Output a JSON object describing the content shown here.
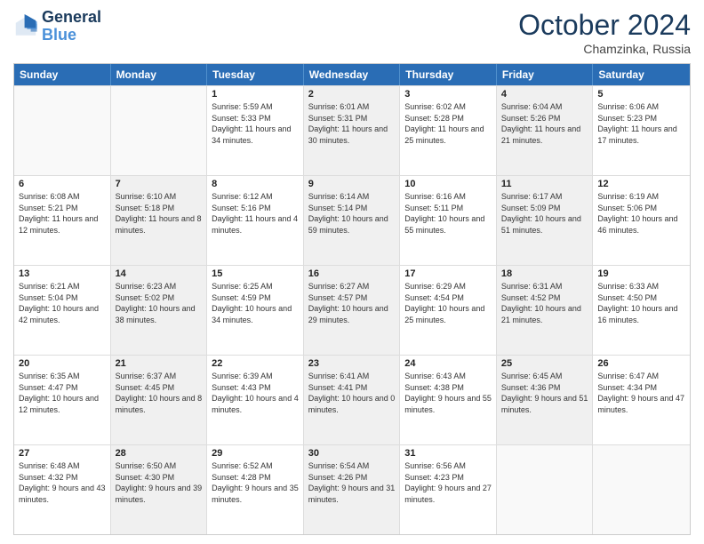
{
  "logo": {
    "line1": "General",
    "line2": "Blue"
  },
  "title": "October 2024",
  "subtitle": "Chamzinka, Russia",
  "days": [
    "Sunday",
    "Monday",
    "Tuesday",
    "Wednesday",
    "Thursday",
    "Friday",
    "Saturday"
  ],
  "weeks": [
    [
      {
        "day": "",
        "sunrise": "",
        "sunset": "",
        "daylight": "",
        "shaded": false,
        "empty": true
      },
      {
        "day": "",
        "sunrise": "",
        "sunset": "",
        "daylight": "",
        "shaded": false,
        "empty": true
      },
      {
        "day": "1",
        "sunrise": "Sunrise: 5:59 AM",
        "sunset": "Sunset: 5:33 PM",
        "daylight": "Daylight: 11 hours and 34 minutes.",
        "shaded": false,
        "empty": false
      },
      {
        "day": "2",
        "sunrise": "Sunrise: 6:01 AM",
        "sunset": "Sunset: 5:31 PM",
        "daylight": "Daylight: 11 hours and 30 minutes.",
        "shaded": true,
        "empty": false
      },
      {
        "day": "3",
        "sunrise": "Sunrise: 6:02 AM",
        "sunset": "Sunset: 5:28 PM",
        "daylight": "Daylight: 11 hours and 25 minutes.",
        "shaded": false,
        "empty": false
      },
      {
        "day": "4",
        "sunrise": "Sunrise: 6:04 AM",
        "sunset": "Sunset: 5:26 PM",
        "daylight": "Daylight: 11 hours and 21 minutes.",
        "shaded": true,
        "empty": false
      },
      {
        "day": "5",
        "sunrise": "Sunrise: 6:06 AM",
        "sunset": "Sunset: 5:23 PM",
        "daylight": "Daylight: 11 hours and 17 minutes.",
        "shaded": false,
        "empty": false
      }
    ],
    [
      {
        "day": "6",
        "sunrise": "Sunrise: 6:08 AM",
        "sunset": "Sunset: 5:21 PM",
        "daylight": "Daylight: 11 hours and 12 minutes.",
        "shaded": false,
        "empty": false
      },
      {
        "day": "7",
        "sunrise": "Sunrise: 6:10 AM",
        "sunset": "Sunset: 5:18 PM",
        "daylight": "Daylight: 11 hours and 8 minutes.",
        "shaded": true,
        "empty": false
      },
      {
        "day": "8",
        "sunrise": "Sunrise: 6:12 AM",
        "sunset": "Sunset: 5:16 PM",
        "daylight": "Daylight: 11 hours and 4 minutes.",
        "shaded": false,
        "empty": false
      },
      {
        "day": "9",
        "sunrise": "Sunrise: 6:14 AM",
        "sunset": "Sunset: 5:14 PM",
        "daylight": "Daylight: 10 hours and 59 minutes.",
        "shaded": true,
        "empty": false
      },
      {
        "day": "10",
        "sunrise": "Sunrise: 6:16 AM",
        "sunset": "Sunset: 5:11 PM",
        "daylight": "Daylight: 10 hours and 55 minutes.",
        "shaded": false,
        "empty": false
      },
      {
        "day": "11",
        "sunrise": "Sunrise: 6:17 AM",
        "sunset": "Sunset: 5:09 PM",
        "daylight": "Daylight: 10 hours and 51 minutes.",
        "shaded": true,
        "empty": false
      },
      {
        "day": "12",
        "sunrise": "Sunrise: 6:19 AM",
        "sunset": "Sunset: 5:06 PM",
        "daylight": "Daylight: 10 hours and 46 minutes.",
        "shaded": false,
        "empty": false
      }
    ],
    [
      {
        "day": "13",
        "sunrise": "Sunrise: 6:21 AM",
        "sunset": "Sunset: 5:04 PM",
        "daylight": "Daylight: 10 hours and 42 minutes.",
        "shaded": false,
        "empty": false
      },
      {
        "day": "14",
        "sunrise": "Sunrise: 6:23 AM",
        "sunset": "Sunset: 5:02 PM",
        "daylight": "Daylight: 10 hours and 38 minutes.",
        "shaded": true,
        "empty": false
      },
      {
        "day": "15",
        "sunrise": "Sunrise: 6:25 AM",
        "sunset": "Sunset: 4:59 PM",
        "daylight": "Daylight: 10 hours and 34 minutes.",
        "shaded": false,
        "empty": false
      },
      {
        "day": "16",
        "sunrise": "Sunrise: 6:27 AM",
        "sunset": "Sunset: 4:57 PM",
        "daylight": "Daylight: 10 hours and 29 minutes.",
        "shaded": true,
        "empty": false
      },
      {
        "day": "17",
        "sunrise": "Sunrise: 6:29 AM",
        "sunset": "Sunset: 4:54 PM",
        "daylight": "Daylight: 10 hours and 25 minutes.",
        "shaded": false,
        "empty": false
      },
      {
        "day": "18",
        "sunrise": "Sunrise: 6:31 AM",
        "sunset": "Sunset: 4:52 PM",
        "daylight": "Daylight: 10 hours and 21 minutes.",
        "shaded": true,
        "empty": false
      },
      {
        "day": "19",
        "sunrise": "Sunrise: 6:33 AM",
        "sunset": "Sunset: 4:50 PM",
        "daylight": "Daylight: 10 hours and 16 minutes.",
        "shaded": false,
        "empty": false
      }
    ],
    [
      {
        "day": "20",
        "sunrise": "Sunrise: 6:35 AM",
        "sunset": "Sunset: 4:47 PM",
        "daylight": "Daylight: 10 hours and 12 minutes.",
        "shaded": false,
        "empty": false
      },
      {
        "day": "21",
        "sunrise": "Sunrise: 6:37 AM",
        "sunset": "Sunset: 4:45 PM",
        "daylight": "Daylight: 10 hours and 8 minutes.",
        "shaded": true,
        "empty": false
      },
      {
        "day": "22",
        "sunrise": "Sunrise: 6:39 AM",
        "sunset": "Sunset: 4:43 PM",
        "daylight": "Daylight: 10 hours and 4 minutes.",
        "shaded": false,
        "empty": false
      },
      {
        "day": "23",
        "sunrise": "Sunrise: 6:41 AM",
        "sunset": "Sunset: 4:41 PM",
        "daylight": "Daylight: 10 hours and 0 minutes.",
        "shaded": true,
        "empty": false
      },
      {
        "day": "24",
        "sunrise": "Sunrise: 6:43 AM",
        "sunset": "Sunset: 4:38 PM",
        "daylight": "Daylight: 9 hours and 55 minutes.",
        "shaded": false,
        "empty": false
      },
      {
        "day": "25",
        "sunrise": "Sunrise: 6:45 AM",
        "sunset": "Sunset: 4:36 PM",
        "daylight": "Daylight: 9 hours and 51 minutes.",
        "shaded": true,
        "empty": false
      },
      {
        "day": "26",
        "sunrise": "Sunrise: 6:47 AM",
        "sunset": "Sunset: 4:34 PM",
        "daylight": "Daylight: 9 hours and 47 minutes.",
        "shaded": false,
        "empty": false
      }
    ],
    [
      {
        "day": "27",
        "sunrise": "Sunrise: 6:48 AM",
        "sunset": "Sunset: 4:32 PM",
        "daylight": "Daylight: 9 hours and 43 minutes.",
        "shaded": false,
        "empty": false
      },
      {
        "day": "28",
        "sunrise": "Sunrise: 6:50 AM",
        "sunset": "Sunset: 4:30 PM",
        "daylight": "Daylight: 9 hours and 39 minutes.",
        "shaded": true,
        "empty": false
      },
      {
        "day": "29",
        "sunrise": "Sunrise: 6:52 AM",
        "sunset": "Sunset: 4:28 PM",
        "daylight": "Daylight: 9 hours and 35 minutes.",
        "shaded": false,
        "empty": false
      },
      {
        "day": "30",
        "sunrise": "Sunrise: 6:54 AM",
        "sunset": "Sunset: 4:26 PM",
        "daylight": "Daylight: 9 hours and 31 minutes.",
        "shaded": true,
        "empty": false
      },
      {
        "day": "31",
        "sunrise": "Sunrise: 6:56 AM",
        "sunset": "Sunset: 4:23 PM",
        "daylight": "Daylight: 9 hours and 27 minutes.",
        "shaded": false,
        "empty": false
      },
      {
        "day": "",
        "sunrise": "",
        "sunset": "",
        "daylight": "",
        "shaded": true,
        "empty": true
      },
      {
        "day": "",
        "sunrise": "",
        "sunset": "",
        "daylight": "",
        "shaded": false,
        "empty": true
      }
    ]
  ]
}
